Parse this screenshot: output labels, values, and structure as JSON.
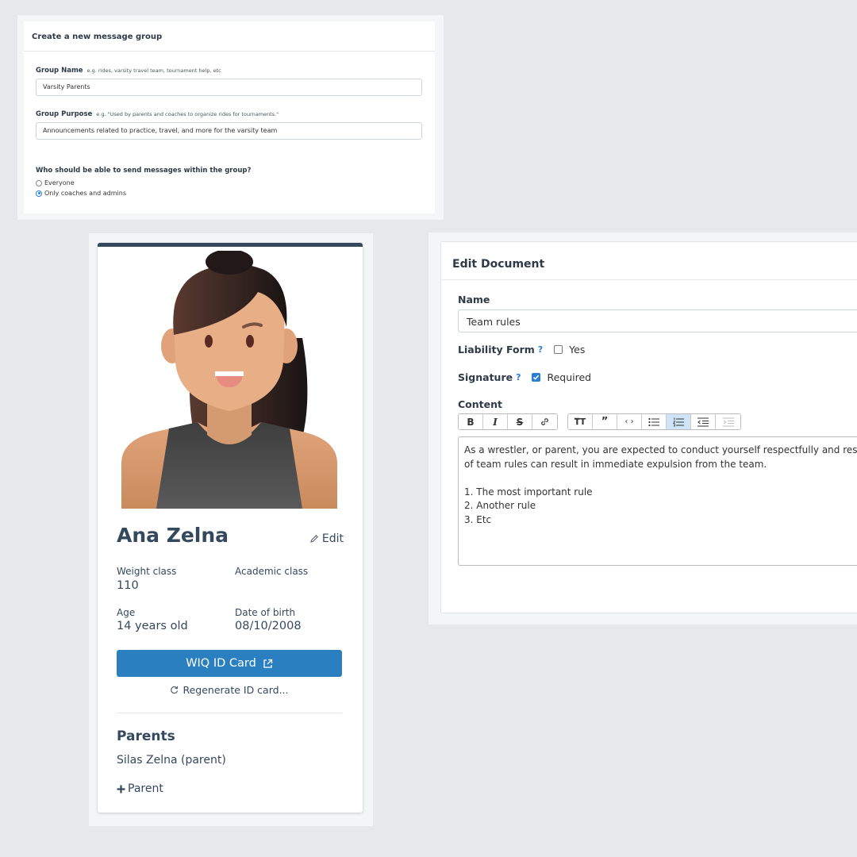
{
  "message_group": {
    "title": "Create a new message group",
    "group_name_label": "Group Name",
    "group_name_hint": "e.g. rides, varsity travel team, tournament help, etc",
    "group_name_value": "Varsity Parents",
    "group_purpose_label": "Group Purpose",
    "group_purpose_hint": "e.g. \"Used by parents and coaches to organize rides for tournaments.\"",
    "group_purpose_value": "Announcements related to practice, travel, and more for the varsity team",
    "question": "Who should be able to send messages within the group?",
    "options": [
      "Everyone",
      "Only coaches and admins"
    ],
    "selected_option": "Only coaches and admins"
  },
  "profile": {
    "name": "Ana Zelna",
    "edit_label": "Edit",
    "weight_class_label": "Weight class",
    "weight_class_value": "110",
    "academic_class_label": "Academic class",
    "age_label": "Age",
    "age_value": "14 years old",
    "dob_label": "Date of birth",
    "dob_value": "08/10/2008",
    "id_card_button": "WIQ ID Card",
    "regenerate_label": "Regenerate ID card...",
    "parents_heading": "Parents",
    "parents": [
      "Silas Zelna (parent)"
    ],
    "add_parent_label": "Parent",
    "accent_color": "#2a7fc0"
  },
  "edit_document": {
    "title": "Edit Document",
    "name_label": "Name",
    "name_value": "Team rules",
    "liability_label": "Liability Form",
    "liability_option": "Yes",
    "liability_checked": false,
    "signature_label": "Signature",
    "signature_option": "Required",
    "signature_checked": true,
    "help_glyph": "?",
    "content_label": "Content",
    "toolbar": [
      "bold-icon",
      "italic-icon",
      "strikethrough-icon",
      "link-icon",
      "heading-icon",
      "quote-icon",
      "code-icon",
      "bullet-list-icon",
      "numbered-list-icon",
      "outdent-icon",
      "indent-icon"
    ],
    "content_lines": [
      "As a wrestler, or parent, you are expected to conduct yourself respectfully and responsibly",
      "of team rules can result in immediate expulsion from the team.",
      "",
      "1. The most important rule",
      "2. Another rule",
      "3. Etc"
    ]
  }
}
